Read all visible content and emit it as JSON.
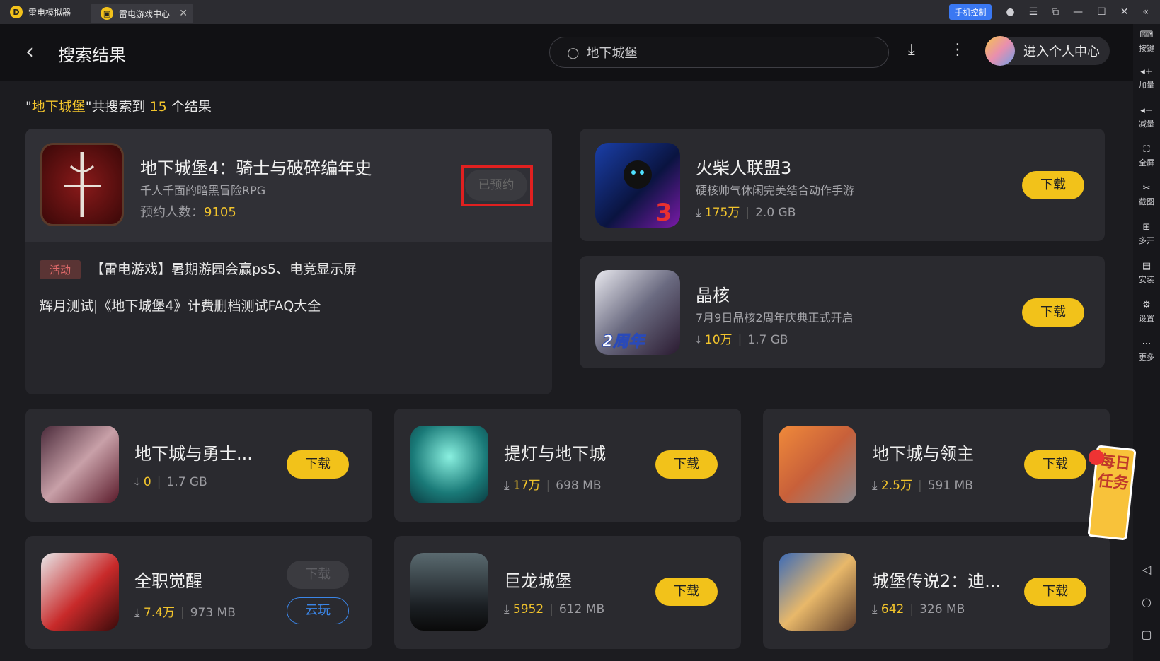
{
  "tabs": [
    {
      "label": "雷电模拟器"
    },
    {
      "label": "雷电游戏中心"
    }
  ],
  "titlebar": {
    "phone_control": "手机控制"
  },
  "sidebar": {
    "items": [
      {
        "icon": "keyboard-icon",
        "label": "按键"
      },
      {
        "icon": "volume-up-icon",
        "label": "加量"
      },
      {
        "icon": "volume-down-icon",
        "label": "减量"
      },
      {
        "icon": "fullscreen-icon",
        "label": "全屏"
      },
      {
        "icon": "scissors-icon",
        "label": "截图"
      },
      {
        "icon": "multi-open-icon",
        "label": "多开"
      },
      {
        "icon": "apk-icon",
        "label": "安装"
      },
      {
        "icon": "gear-icon",
        "label": "设置"
      },
      {
        "icon": "more-icon",
        "label": "更多"
      }
    ]
  },
  "header": {
    "title": "搜索结果",
    "search_value": "地下城堡",
    "user_label": "进入个人中心"
  },
  "summary": {
    "quote_open": "\"",
    "keyword": "地下城堡",
    "quote_close": "\"",
    "mid": "共搜索到",
    "count": "15",
    "end": "个结果"
  },
  "featured": {
    "title": "地下城堡4：骑士与破碎编年史",
    "subtitle": "千人千面的暗黑冒险RPG",
    "reserve_label": "预约人数：",
    "reserve_count": "9105",
    "button": "已预约",
    "activity_tag": "活动",
    "activity_text": "【雷电游戏】暑期游园会赢ps5、电竞显示屏",
    "news2": "辉月测试|《地下城堡4》计费删档测试FAQ大全"
  },
  "right_games": [
    {
      "title": "火柴人联盟3",
      "subtitle": "硬核帅气休闲完美结合动作手游",
      "downloads": "175万",
      "size": "2.0 GB",
      "button": "下载"
    },
    {
      "title": "晶核",
      "subtitle": "7月9日晶核2周年庆典正式开启",
      "downloads": "10万",
      "size": "1.7 GB",
      "button": "下载"
    }
  ],
  "grid_games": [
    {
      "title": "地下城与勇士...",
      "downloads": "0",
      "size": "1.7 GB",
      "button": "下载"
    },
    {
      "title": "提灯与地下城",
      "downloads": "17万",
      "size": "698 MB",
      "button": "下载"
    },
    {
      "title": "地下城与领主",
      "downloads": "2.5万",
      "size": "591 MB",
      "button": "下载"
    },
    {
      "title": "全职觉醒",
      "downloads": "7.4万",
      "size": "973 MB",
      "button": "下载",
      "button2": "云玩"
    },
    {
      "title": "巨龙城堡",
      "downloads": "5952",
      "size": "612 MB",
      "button": "下载"
    },
    {
      "title": "城堡传说2：迪...",
      "downloads": "642",
      "size": "326 MB",
      "button": "下载"
    }
  ],
  "daily_task": "每日任务",
  "colors": {
    "accent": "#f2c21a",
    "highlight": "#e02020",
    "cloud": "#3b86e8"
  }
}
